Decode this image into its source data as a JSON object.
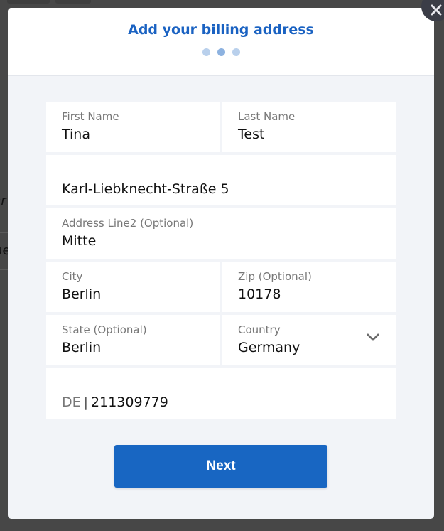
{
  "modal": {
    "title": "Add your billing address",
    "steps": {
      "total": 3,
      "current": 2
    },
    "close_icon": "close-icon"
  },
  "form": {
    "first_name": {
      "label": "First Name",
      "value": "Tina"
    },
    "last_name": {
      "label": "Last Name",
      "value": "Test"
    },
    "address_line1": {
      "label": "",
      "value": "Karl-Liebknecht-Straße 5"
    },
    "address_line2": {
      "label": "Address Line2 (Optional)",
      "value": "Mitte"
    },
    "city": {
      "label": "City",
      "value": "Berlin"
    },
    "zip": {
      "label": "Zip (Optional)",
      "value": "10178"
    },
    "state": {
      "label": "State (Optional)",
      "value": "Berlin"
    },
    "country": {
      "label": "Country",
      "value": "Germany",
      "icon": "chevron-down-icon"
    },
    "phone": {
      "prefix": "DE",
      "separator": "|",
      "value": "211309779"
    }
  },
  "actions": {
    "next_label": "Next"
  },
  "colors": {
    "accent": "#1866c2",
    "title": "#1a62c2",
    "panel_bg": "#f2f4f8"
  }
}
